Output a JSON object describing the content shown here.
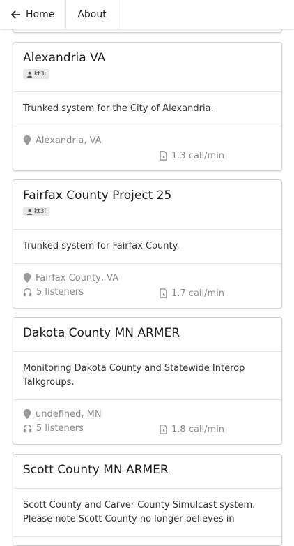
{
  "nav": {
    "home": "Home",
    "about": "About"
  },
  "cards": [
    {
      "title": "Alexandria VA",
      "user": "kt3i",
      "description": "Trunked system for the City of Alexandria.",
      "location": "Alexandria, VA",
      "listeners": "",
      "rate": "1.3 call/min"
    },
    {
      "title": "Fairfax County  Project 25",
      "user": "kt3i",
      "description": "Trunked system for Fairfax County.",
      "location": "Fairfax County, VA",
      "listeners": "5 listeners",
      "rate": "1.7 call/min"
    },
    {
      "title": "Dakota County  MN ARMER",
      "user": "",
      "description": "Monitoring Dakota County and Statewide Interop Talkgroups.",
      "location": "undefined, MN",
      "listeners": "5 listeners",
      "rate": "1.8 call/min"
    },
    {
      "title": "Scott County  MN ARMER",
      "user": "",
      "description": "Scott County and Carver County Simulcast system. Please note Scott County no longer believes in",
      "location": "",
      "listeners": "",
      "rate": ""
    }
  ]
}
